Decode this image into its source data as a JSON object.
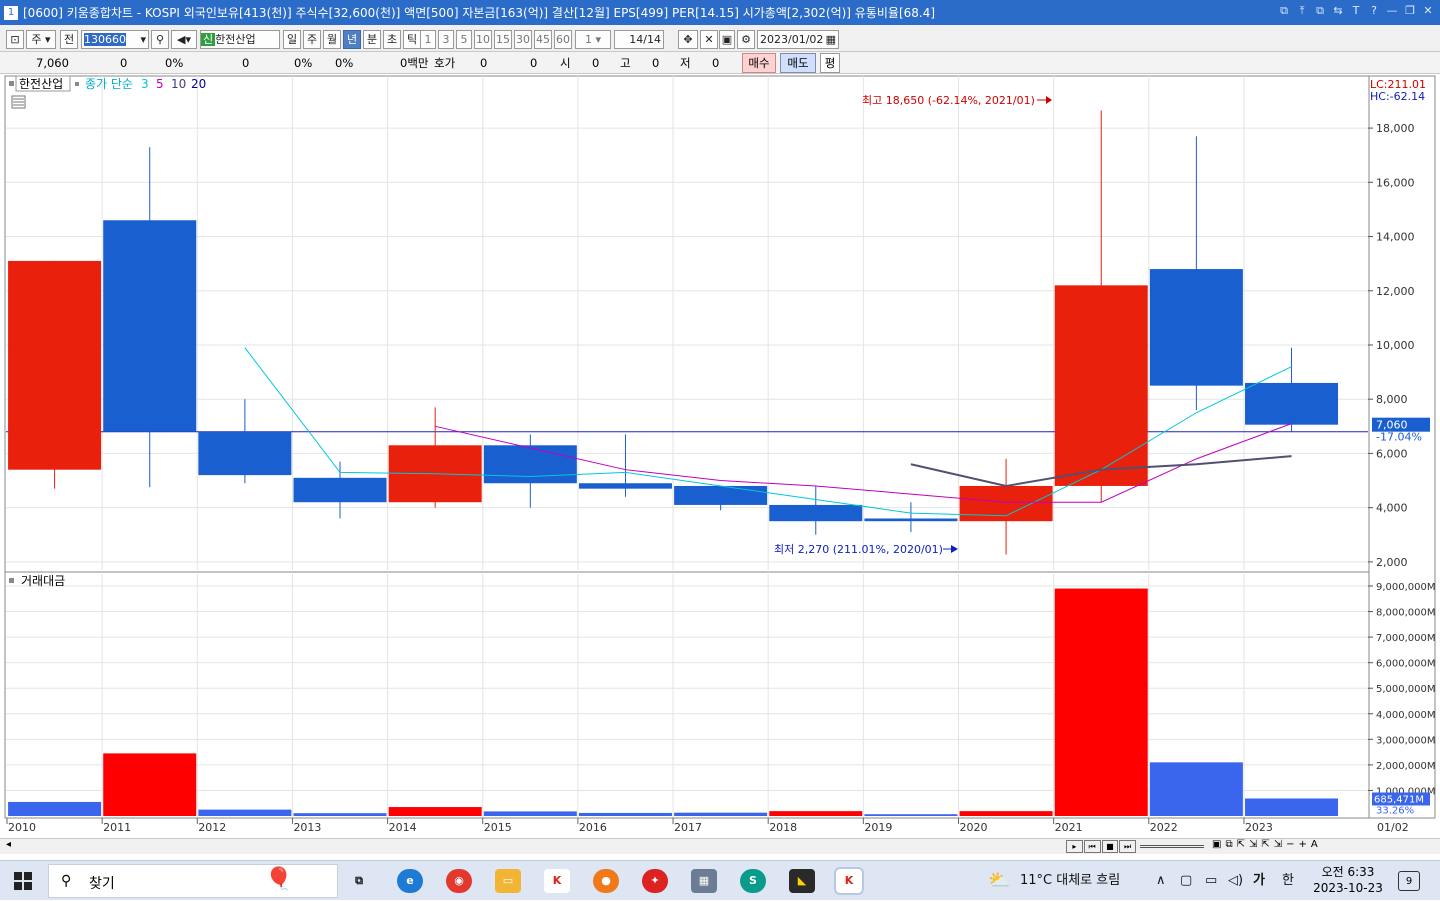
{
  "window": {
    "badge": "1",
    "title": "[0600] 키움종합차트 - KOSPI 외국인보유[413(천)] 주식수[32,600(천)] 액면[500] 자본금[163(억)] 결산[12월] EPS[499] PER[14.15] 시가총액[2,302(억)] 유통비율[68.4]",
    "controls": [
      "⧉",
      "⤒",
      "⧉",
      "⇆",
      "T",
      "?",
      "—",
      "❐",
      "✕"
    ]
  },
  "toolbar": {
    "mode_label": "주",
    "all_label": "전",
    "code_value": "130660",
    "stock_label": "한전산업",
    "stock_prefix": "신",
    "period_buttons": [
      "일",
      "주",
      "월",
      "년",
      "분",
      "초",
      "틱"
    ],
    "active_period": "년",
    "minute_buttons": [
      "1",
      "3",
      "5",
      "10",
      "15",
      "30",
      "45",
      "60"
    ],
    "count_value": "1",
    "range_value": "14",
    "range_total": "/14",
    "date_value": "2023/01/02"
  },
  "inforow": {
    "price": "7,060",
    "change": "0",
    "change_pct": "0%",
    "v1": "0",
    "v1_pct": "0%",
    "v2_pct": "0%",
    "amount": "0백만",
    "hoga_label": "호가",
    "hoga1": "0",
    "hoga2": "0",
    "open_label": "시",
    "open": "0",
    "high_label": "고",
    "high": "0",
    "low_label": "저",
    "low": "0",
    "buy_label": "매수",
    "sell_label": "매도",
    "avg_label": "평"
  },
  "price_panel": {
    "legend_stock": "한전산업",
    "legend_ma": "종가 단순",
    "ma_periods": [
      {
        "label": "3",
        "color": "#00c8d8"
      },
      {
        "label": "5",
        "color": "#c000c0"
      },
      {
        "label": "10",
        "color": "#404080"
      },
      {
        "label": "20",
        "color": "#0000a0"
      }
    ],
    "lc_label": "LC:211.01",
    "hc_label": "HC:-62.14",
    "high_annotation": "최고 18,650 (-62.14%, 2021/01)",
    "low_annotation": "최저 2,270 (211.01%, 2020/01)",
    "ref_line_label": "6,800",
    "current_price_label": "7,060",
    "current_pct_label": "-17.04%",
    "y_ticks": [
      "18,000",
      "16,000",
      "14,000",
      "12,000",
      "10,000",
      "8,000",
      "6,000",
      "4,000",
      "2,000"
    ]
  },
  "volume_panel": {
    "title": "거래대금",
    "y_ticks": [
      "9,000,000M",
      "8,000,000M",
      "7,000,000M",
      "6,000,000M",
      "5,000,000M",
      "4,000,000M",
      "3,000,000M",
      "2,000,000M",
      "1,000,000M"
    ],
    "current_label": "685,471M",
    "current_pct": "33.26%"
  },
  "x_labels": [
    "2010",
    "2011",
    "2012",
    "2013",
    "2014",
    "2015",
    "2016",
    "2017",
    "2018",
    "2019",
    "2020",
    "2021",
    "2022",
    "2023"
  ],
  "x_end_label": "01/02",
  "chart_data": {
    "type": "candlestick",
    "categories": [
      "2010",
      "2011",
      "2012",
      "2013",
      "2014",
      "2015",
      "2016",
      "2017",
      "2018",
      "2019",
      "2020",
      "2021",
      "2022",
      "2023"
    ],
    "candles": [
      {
        "open": 5400,
        "close": 13100,
        "high": 13100,
        "low": 4700,
        "up": true
      },
      {
        "open": 14600,
        "close": 6800,
        "high": 17300,
        "low": 4750,
        "up": false
      },
      {
        "open": 6800,
        "close": 5200,
        "high": 8000,
        "low": 4900,
        "up": false
      },
      {
        "open": 5100,
        "close": 4200,
        "high": 5700,
        "low": 3600,
        "up": false
      },
      {
        "open": 4200,
        "close": 6300,
        "high": 7700,
        "low": 4000,
        "up": true
      },
      {
        "open": 6300,
        "close": 4900,
        "high": 6700,
        "low": 4000,
        "up": false
      },
      {
        "open": 4900,
        "close": 4700,
        "high": 6700,
        "low": 4400,
        "up": false
      },
      {
        "open": 4800,
        "close": 4100,
        "high": 4800,
        "low": 3900,
        "up": false
      },
      {
        "open": 4100,
        "close": 3500,
        "high": 4800,
        "low": 3000,
        "up": false
      },
      {
        "open": 3600,
        "close": 3500,
        "high": 4200,
        "low": 3100,
        "up": false
      },
      {
        "open": 3500,
        "close": 4800,
        "high": 5800,
        "low": 2270,
        "up": true
      },
      {
        "open": 4800,
        "close": 12200,
        "high": 18650,
        "low": 4200,
        "up": true
      },
      {
        "open": 12800,
        "close": 8500,
        "high": 17700,
        "low": 7600,
        "up": false
      },
      {
        "open": 8600,
        "close": 7060,
        "high": 9900,
        "low": 6800,
        "up": false
      }
    ],
    "ma3": [
      null,
      null,
      9900,
      5300,
      5250,
      5150,
      5300,
      4800,
      4300,
      3800,
      3700,
      5400,
      7500,
      9200
    ],
    "ma5": [
      null,
      null,
      null,
      null,
      7000,
      6200,
      5400,
      5000,
      4800,
      4500,
      4200,
      4200,
      5800,
      7100
    ],
    "ma10": [
      null,
      null,
      null,
      null,
      null,
      null,
      null,
      null,
      null,
      5600,
      4800,
      5400,
      5600,
      5900
    ],
    "volume": [
      550000,
      2450000,
      250000,
      110000,
      350000,
      180000,
      120000,
      130000,
      190000,
      70000,
      190000,
      8900000,
      2100000,
      685471
    ],
    "volume_up": [
      false,
      true,
      false,
      false,
      true,
      false,
      false,
      false,
      true,
      false,
      true,
      true,
      false,
      false
    ],
    "ylim": [
      1700,
      19700
    ],
    "volume_ylim": [
      0,
      9000000
    ]
  },
  "hscroll": {
    "controls": [
      "⏮",
      "⏭",
      "■",
      "⏭"
    ]
  },
  "taskbar": {
    "search_placeholder": "찾기",
    "weather": "11°C  대체로 흐림",
    "ime1": "가",
    "ime2": "한",
    "time": "오전 6:33",
    "date": "2023-10-23",
    "notif_count": "9"
  }
}
